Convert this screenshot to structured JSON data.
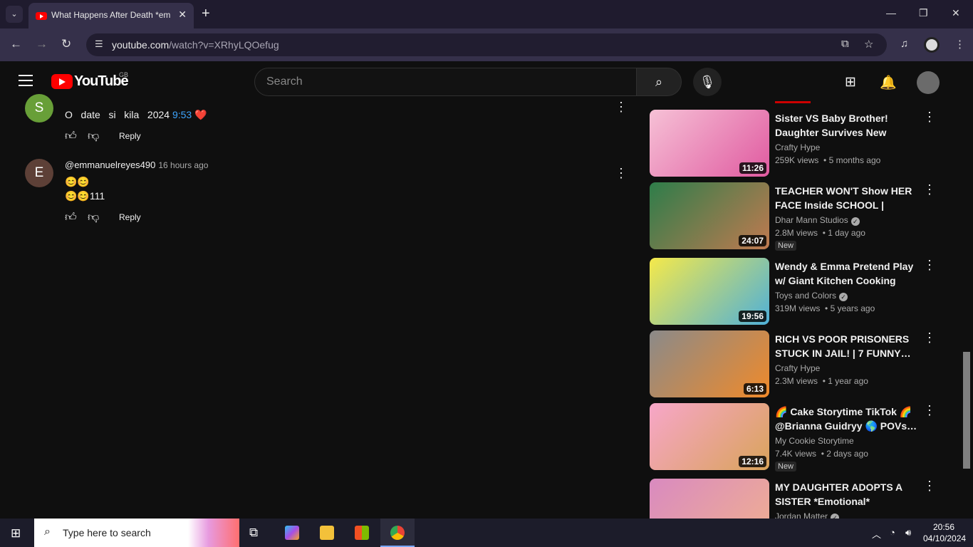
{
  "browser": {
    "tab_title": "What Happens After Death *em",
    "url_host": "youtube.com",
    "url_path": "/watch?v=XRhyLQOefug"
  },
  "youtube": {
    "logo_text": "YouTube",
    "region": "GB",
    "search_placeholder": "Search"
  },
  "comments": [
    {
      "avatar_letter": "S",
      "avatar_color": "#689f38",
      "text_before": "O   date   si   kila   2024 ",
      "timestamp": "9:53",
      "emoji": "❤️",
      "reply": "Reply"
    },
    {
      "avatar_letter": "E",
      "avatar_color": "#5d4037",
      "username": "@emmanuelreyes490",
      "time": "16 hours ago",
      "line1": "😊😊",
      "line2": "😊😊111",
      "reply": "Reply"
    }
  ],
  "recommendations": [
    {
      "title": "Sister VS Baby Brother! Daughter Survives New Broth…",
      "channel": "Crafty Hype",
      "views": "259K views",
      "age": "• 5 months ago",
      "duration": "11:26",
      "new": "",
      "verified": false,
      "thumb_colors": [
        "#f6c1d6",
        "#e05aa0"
      ]
    },
    {
      "title": "TEACHER WON'T Show HER FACE Inside SCHOOL | Dhar…",
      "channel": "Dhar Mann Studios",
      "views": "2.8M views",
      "age": "• 1 day ago",
      "duration": "24:07",
      "new": "New",
      "verified": true,
      "thumb_colors": [
        "#2e7d4a",
        "#c07a50"
      ]
    },
    {
      "title": "Wendy & Emma Pretend Play w/ Giant Kitchen Cooking Toy…",
      "channel": "Toys and Colors",
      "views": "319M views",
      "age": "• 5 years ago",
      "duration": "19:56",
      "new": "",
      "verified": true,
      "thumb_colors": [
        "#f5e94a",
        "#4fb0d8"
      ]
    },
    {
      "title": "RICH VS POOR PRISONERS STUCK IN JAIL! | 7 FUNNY…",
      "channel": "Crafty Hype",
      "views": "2.3M views",
      "age": "• 1 year ago",
      "duration": "6:13",
      "new": "",
      "verified": false,
      "thumb_colors": [
        "#8a8a8a",
        "#f08a2a"
      ]
    },
    {
      "title": "🌈 Cake Storytime TikTok 🌈 @Brianna Guidryy 🌎 POVs…",
      "channel": "My Cookie Storytime",
      "views": "7.4K views",
      "age": "• 2 days ago",
      "duration": "12:16",
      "new": "New",
      "verified": false,
      "thumb_colors": [
        "#f7a6c9",
        "#d9a35a"
      ]
    },
    {
      "title": "MY DAUGHTER ADOPTS A SISTER *Emotional*",
      "channel": "Jordan Matter",
      "views": "",
      "age": "",
      "duration": "",
      "new": "",
      "verified": true,
      "thumb_colors": [
        "#d98ac0",
        "#f0b090"
      ]
    }
  ],
  "taskbar": {
    "search_placeholder": "Type here to search",
    "time": "20:56",
    "date": "04/10/2024"
  }
}
